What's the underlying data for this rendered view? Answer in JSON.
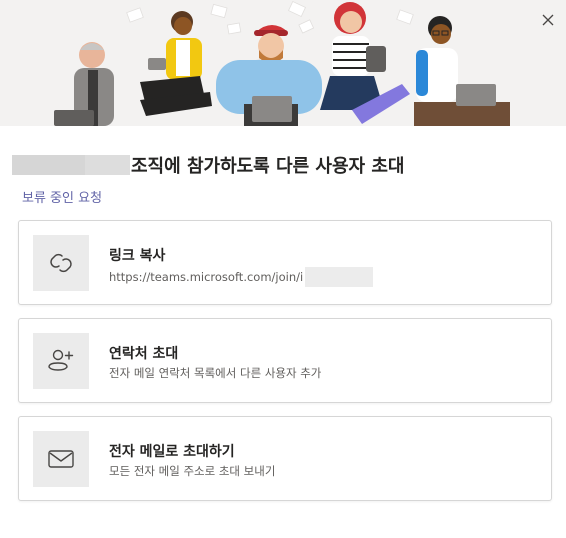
{
  "dialog": {
    "title": "조직에 참가하도록 다른 사용자 초대",
    "pending_link": "보류 중인 요청"
  },
  "options": [
    {
      "title": "링크 복사",
      "subtitle": "https://teams.microsoft.com/join/i",
      "icon": "link-icon"
    },
    {
      "title": "연락처 초대",
      "subtitle": "전자 메일 연락처 목록에서 다른 사용자 추가",
      "icon": "add-person-icon"
    },
    {
      "title": "전자 메일로 초대하기",
      "subtitle": "모든 전자 메일 주소로 초대 보내기",
      "icon": "mail-icon"
    }
  ],
  "colors": {
    "accent": "#6264a7",
    "hero_background": "#f3f2f1",
    "icon_tile": "#ebebeb"
  }
}
